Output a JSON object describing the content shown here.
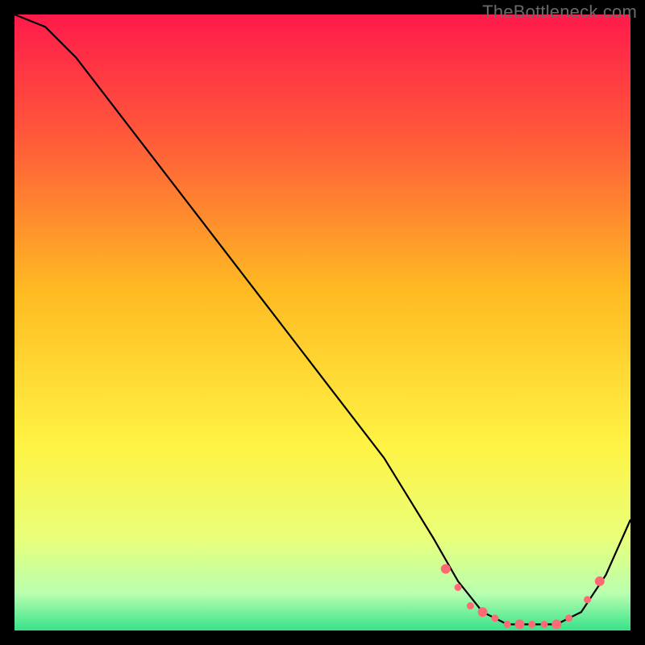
{
  "watermark": "TheBottleneck.com",
  "chart_data": {
    "type": "line",
    "title": "",
    "xlabel": "",
    "ylabel": "",
    "xlim": [
      0,
      100
    ],
    "ylim": [
      0,
      100
    ],
    "gradient_stops": [
      {
        "pct": 0,
        "color": "#ff1a4b"
      },
      {
        "pct": 20,
        "color": "#ff5a3a"
      },
      {
        "pct": 45,
        "color": "#ffbb22"
      },
      {
        "pct": 70,
        "color": "#fff344"
      },
      {
        "pct": 85,
        "color": "#e9ff7a"
      },
      {
        "pct": 94,
        "color": "#b9ffb0"
      },
      {
        "pct": 100,
        "color": "#37e28a"
      }
    ],
    "series": [
      {
        "name": "bottleneck-curve",
        "x": [
          0,
          5,
          10,
          20,
          30,
          40,
          50,
          60,
          68,
          72,
          76,
          80,
          84,
          88,
          92,
          96,
          100
        ],
        "y": [
          100,
          98,
          93,
          80,
          67,
          54,
          41,
          28,
          15,
          8,
          3,
          1,
          1,
          1,
          3,
          9,
          18
        ]
      }
    ],
    "markers": {
      "name": "highlight-dots",
      "color": "#ff6b75",
      "x": [
        70,
        72,
        74,
        76,
        78,
        80,
        82,
        84,
        86,
        88,
        90,
        93,
        95
      ],
      "y": [
        10,
        7,
        4,
        3,
        2,
        1,
        1,
        1,
        1,
        1,
        2,
        5,
        8
      ]
    }
  }
}
